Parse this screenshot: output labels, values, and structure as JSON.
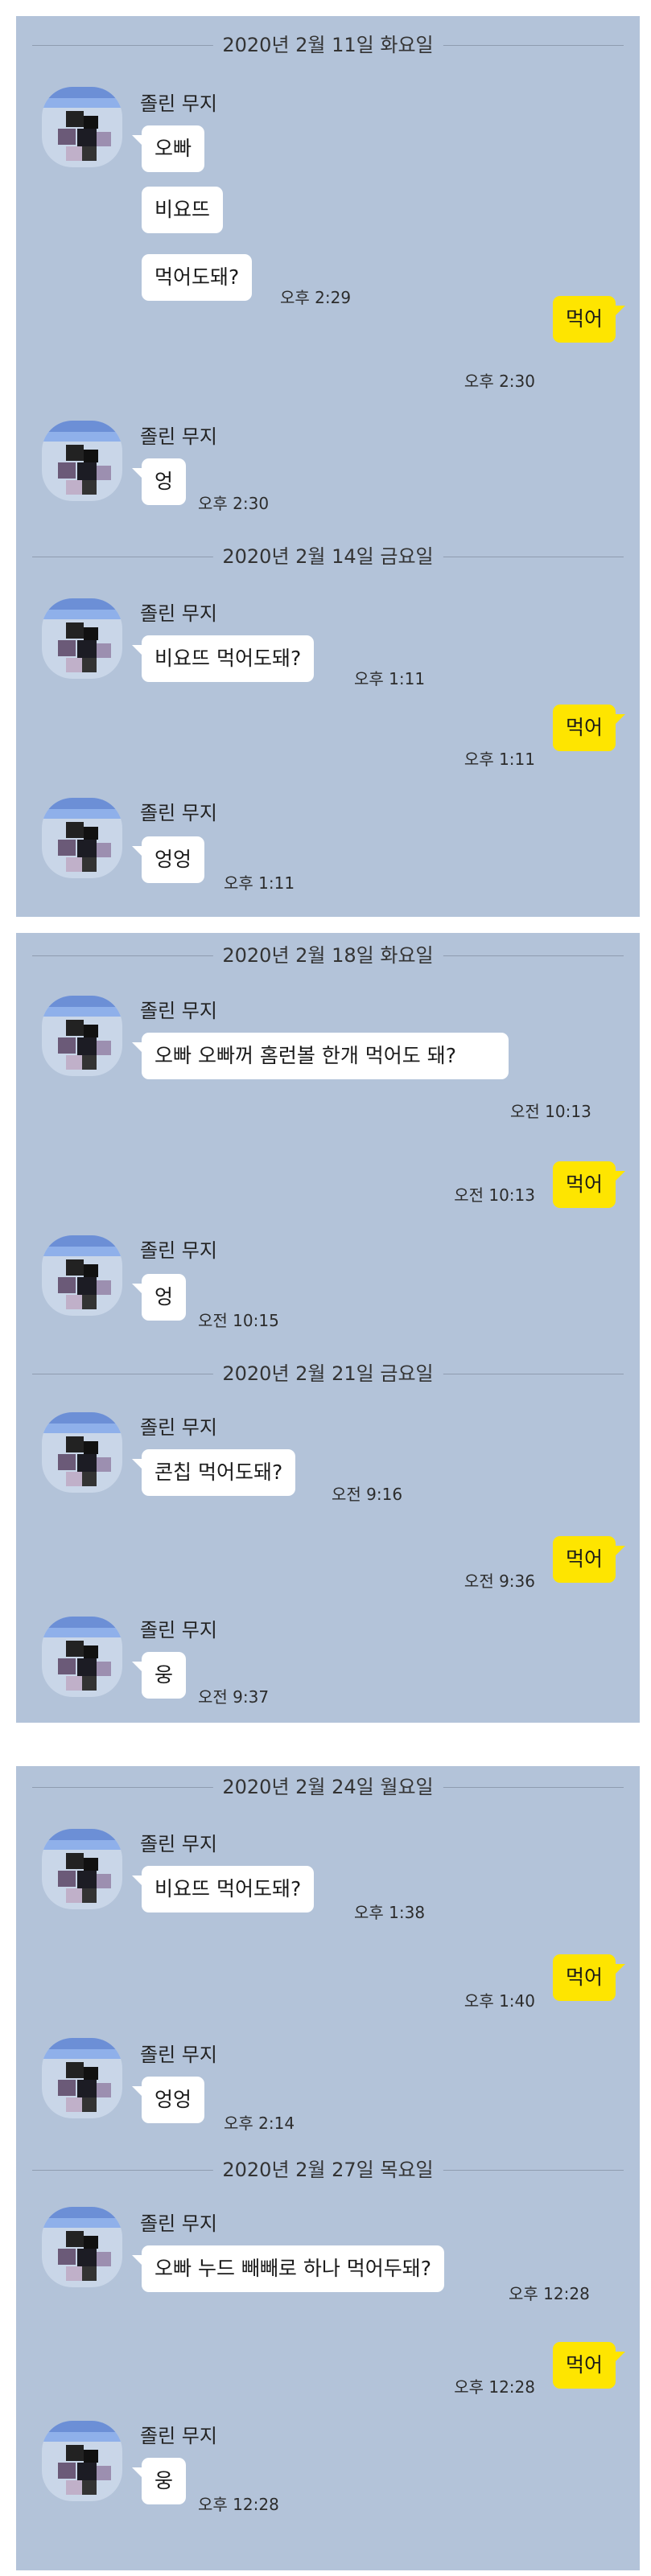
{
  "sender": "졸린 무지",
  "colors": {
    "background": "#b3c3d9",
    "my_bubble": "#fee500",
    "their_bubble": "#ffffff"
  },
  "screens": [
    {
      "days": [
        {
          "date": "2020년 2월 11일 화요일",
          "messages": [
            {
              "from": "other",
              "lines": [
                "오빠",
                "비요뜨",
                "먹어도돼?"
              ],
              "time": "오후 2:29"
            },
            {
              "from": "me",
              "text": "먹어",
              "time": "오후 2:30"
            },
            {
              "from": "other",
              "lines": [
                "엉"
              ],
              "time": "오후 2:30"
            }
          ]
        },
        {
          "date": "2020년 2월 14일 금요일",
          "messages": [
            {
              "from": "other",
              "lines": [
                "비요뜨 먹어도돼?"
              ],
              "time": "오후 1:11"
            },
            {
              "from": "me",
              "text": "먹어",
              "time": "오후 1:11"
            },
            {
              "from": "other",
              "lines": [
                "엉엉"
              ],
              "time": "오후 1:11"
            }
          ]
        }
      ]
    },
    {
      "days": [
        {
          "date": "2020년 2월 18일 화요일",
          "messages": [
            {
              "from": "other",
              "lines": [
                "오빠 오빠꺼 홈런볼 한개 먹어도 돼?"
              ],
              "time": "오전 10:13"
            },
            {
              "from": "me",
              "text": "먹어",
              "time": "오전 10:13"
            },
            {
              "from": "other",
              "lines": [
                "엉"
              ],
              "time": "오전 10:15"
            }
          ]
        },
        {
          "date": "2020년 2월 21일 금요일",
          "messages": [
            {
              "from": "other",
              "lines": [
                "콘칩 먹어도돼?"
              ],
              "time": "오전 9:16"
            },
            {
              "from": "me",
              "text": "먹어",
              "time": "오전 9:36"
            },
            {
              "from": "other",
              "lines": [
                "웅"
              ],
              "time": "오전 9:37"
            }
          ]
        }
      ]
    },
    {
      "days": [
        {
          "date": "2020년 2월 24일 월요일",
          "messages": [
            {
              "from": "other",
              "lines": [
                "비요뜨 먹어도돼?"
              ],
              "time": "오후 1:38"
            },
            {
              "from": "me",
              "text": "먹어",
              "time": "오후 1:40"
            },
            {
              "from": "other",
              "lines": [
                "엉엉"
              ],
              "time": "오후 2:14"
            }
          ]
        },
        {
          "date": "2020년 2월 27일 목요일",
          "messages": [
            {
              "from": "other",
              "lines": [
                "오빠 누드 빼빼로 하나 먹어두돼?"
              ],
              "time": "오후 12:28"
            },
            {
              "from": "me",
              "text": "먹어",
              "time": "오후 12:28"
            },
            {
              "from": "other",
              "lines": [
                "웅"
              ],
              "time": "오후 12:28"
            }
          ]
        }
      ]
    }
  ]
}
